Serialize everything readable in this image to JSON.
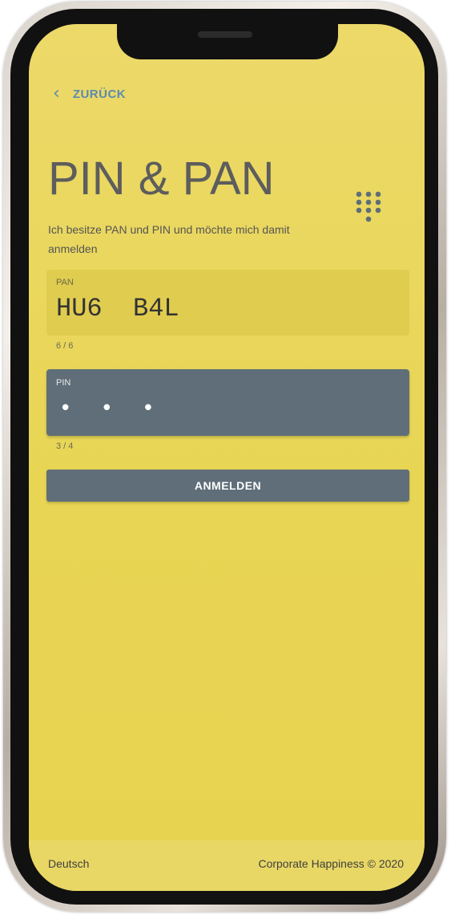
{
  "header": {
    "back_label": "ZURÜCK",
    "back_icon": "chevron-left-icon"
  },
  "main": {
    "title": "PIN & PAN",
    "keypad_icon": "dialpad-icon",
    "subtitle": "Ich besitze PAN und PIN und möchte mich damit anmelden"
  },
  "form": {
    "pan": {
      "label": "PAN",
      "value": "HU6  B4L",
      "counter": "6 / 6"
    },
    "pin": {
      "label": "PIN",
      "value": "• • •",
      "counter": "3 / 4"
    },
    "submit_label": "ANMELDEN"
  },
  "footer": {
    "language": "Deutsch",
    "copyright": "Corporate Happiness © 2020"
  },
  "colors": {
    "background": "#e8d553",
    "accent_link": "#5b8bb0",
    "field_active": "#5f6e78",
    "field_pan": "#e0cc4f"
  }
}
